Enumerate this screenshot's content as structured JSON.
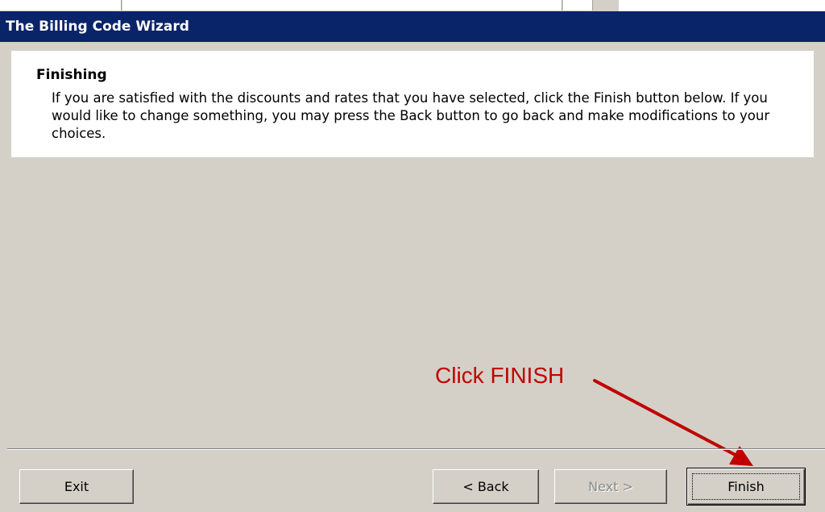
{
  "window": {
    "title": "The Billing Code Wizard"
  },
  "header": {
    "heading": "Finishing",
    "description": "If you are satisfied with the discounts and rates that you have selected, click the Finish button below.  If you would like to change something, you may press the Back button to go back and make modifications to your choices."
  },
  "annotation": {
    "text": "Click FINISH",
    "color": "#c00000"
  },
  "buttons": {
    "exit": "Exit",
    "back": "< Back",
    "next": "Next >",
    "finish": "Finish"
  },
  "colors": {
    "title_bar": "#0a246a",
    "dialog_bg": "#d4d0c8",
    "header_bg": "#ffffff"
  }
}
